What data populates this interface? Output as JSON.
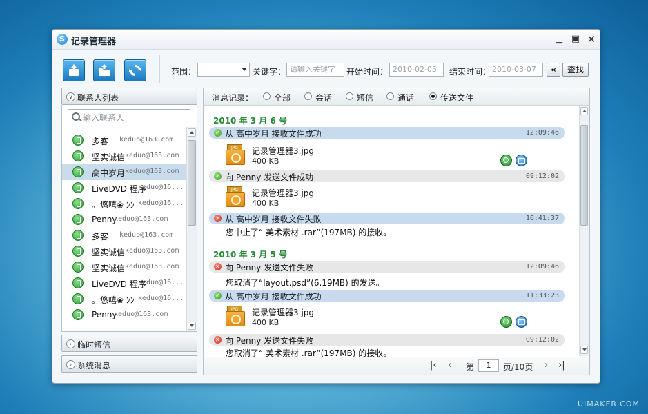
{
  "window": {
    "title": "记录管理器",
    "logo": "S"
  },
  "toolbar": {
    "range_label": "范围：",
    "range_value": "",
    "keyword_label": "关键字：",
    "keyword_placeholder": "请输入关键字",
    "start_label": "开始时间：",
    "start_value": "2010-02-05",
    "end_label": "结束时间：",
    "end_value": "2010-03-07",
    "back_btn": "«",
    "search_btn": "查找"
  },
  "left": {
    "contacts_header": "联系人列表",
    "search_placeholder": "输入联系人",
    "contacts": [
      {
        "name": "多客",
        "email": "keduo@163.com"
      },
      {
        "name": "坚实诚信",
        "email": "keduo@163.com"
      },
      {
        "name": "高中岁月",
        "email": "keduo@163.com"
      },
      {
        "name": "LiveDVD 程序",
        "email": "keduo@16..."
      },
      {
        "name": "。悠嘻❀ ﾝﾝ",
        "email": "keduo@16..."
      },
      {
        "name": "Penny",
        "email": "keduo@163.com"
      },
      {
        "name": "多客",
        "email": "keduo@163.com"
      },
      {
        "name": "坚实诚信",
        "email": "keduo@163.com"
      },
      {
        "name": "坚实诚信",
        "email": "keduo@163.com"
      },
      {
        "name": "LiveDVD 程序",
        "email": "keduo@16..."
      },
      {
        "name": "。悠嘻❀ ﾝﾝ",
        "email": "keduo@16..."
      },
      {
        "name": "Penny",
        "email": "keduo@163.com"
      }
    ],
    "sms_header": "临时短信",
    "sys_header": "系统消息"
  },
  "right": {
    "filter_label": "消息记录：",
    "filters": [
      "全部",
      "会话",
      "短信",
      "通话",
      "传送文件"
    ],
    "date1": "2010 年 3 月 6 号",
    "date2": "2010 年 3 月 5 号",
    "events": [
      {
        "text": "从  高中岁月  接收文件成功",
        "time": "12:09:46"
      },
      {
        "text": "向 Penny 发送文件成功",
        "time": "09:12:02"
      },
      {
        "text": "从  高中岁月  接收文件失败",
        "time": "16:41:37"
      },
      {
        "text": "向 Penny 发送文件失败",
        "time": "12:09:46"
      },
      {
        "text": "从  高中岁月  接收文件成功",
        "time": "11:33:23"
      },
      {
        "text": "向 Penny 发送文件失败",
        "time": "09:12:02"
      }
    ],
    "files": [
      {
        "name": "记录管理器3.jpg",
        "size": "400 KB"
      },
      {
        "name": "记录管理器3.jpg",
        "size": "400 KB"
      },
      {
        "name": "记录管理器3.jpg",
        "size": "400 KB"
      }
    ],
    "msg1": "您中止了“ 美术素材 .rar”(197MB) 的接收。",
    "msg2": "您取消了“layout.psd”(6.19MB) 的发送。",
    "msg3": "您取消了“ 美术素材 .rar”(197MB) 的接收。",
    "pager": {
      "page_label": "第",
      "page_value": "1",
      "total": "页/10页"
    }
  },
  "watermark": "UIMAKER.COM",
  "colors": {
    "accent": "#1a78c2",
    "date_green": "#2a8a3a",
    "selected_row": "#c9dcec"
  }
}
